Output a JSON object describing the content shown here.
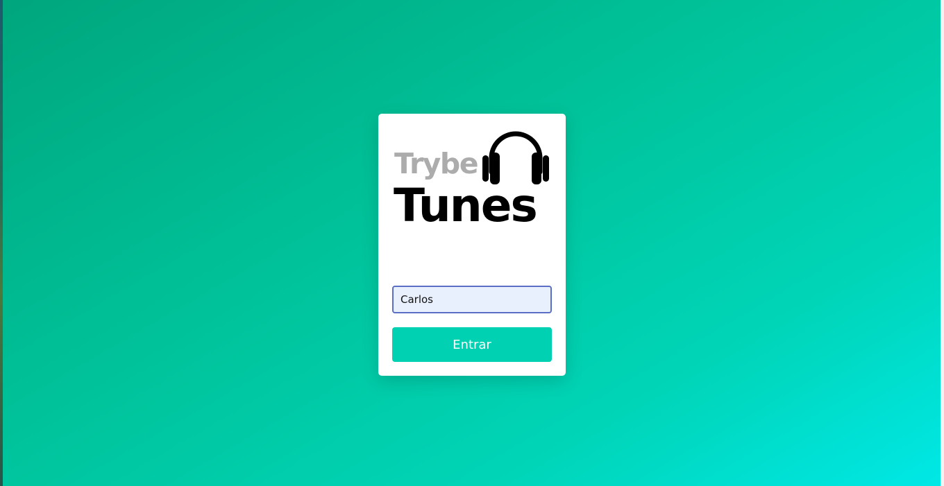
{
  "logo": {
    "brand_top": "Trybe",
    "brand_bottom": "Tunes",
    "icon": "headphones-icon"
  },
  "login": {
    "name_value": "Carlos",
    "button_label": "Entrar"
  },
  "colors": {
    "background_start": "#00a67d",
    "background_end": "#00e8e6",
    "button": "#00d1b2",
    "input_background": "#e8f0fe",
    "input_border": "#5a6fc4",
    "trybe_text": "#acacac",
    "tunes_text": "#000000"
  }
}
